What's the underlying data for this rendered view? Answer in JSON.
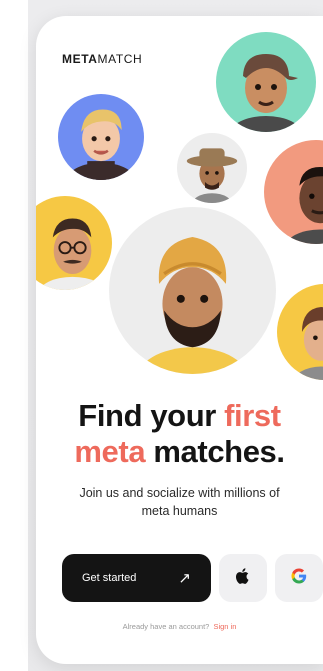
{
  "brand": {
    "logo_bold": "META",
    "logo_light": "MATCH"
  },
  "headline": {
    "line1_a": "Find your ",
    "line1_b": "first",
    "line2_a": "meta",
    "line2_b": " matches."
  },
  "subtitle": "Join us and socialize with millions of meta humans",
  "actions": {
    "get_started": "Get started",
    "arrow_icon": "arrow-up-right-icon",
    "apple_icon": "apple-icon",
    "google_icon": "google-icon"
  },
  "footer": {
    "question": "Already have an account?",
    "signin": "Sign in"
  },
  "colors": {
    "accent": "#ee6a5c",
    "dark": "#141414",
    "avatar_blue": "#6f8df2",
    "avatar_mint": "#7fdcc1",
    "avatar_salmon": "#f29a7f",
    "avatar_yellow": "#f6c844",
    "avatar_grey": "#ededed"
  }
}
